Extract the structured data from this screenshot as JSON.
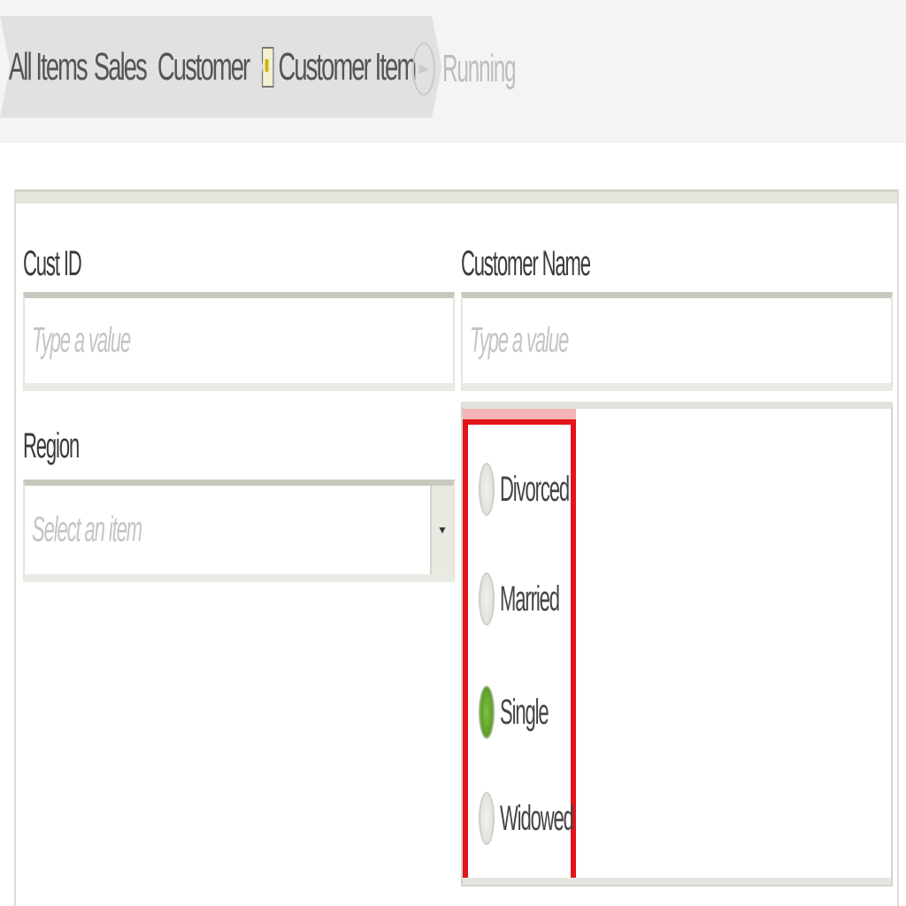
{
  "breadcrumb": {
    "items": [
      {
        "label": "All Items"
      },
      {
        "label": "Sales"
      },
      {
        "label": "Customer"
      },
      {
        "label": "Customer Item"
      }
    ],
    "status": "Running"
  },
  "form": {
    "cust_id": {
      "label": "Cust ID",
      "placeholder": "Type a value"
    },
    "customer_name": {
      "label": "Customer Name",
      "placeholder": "Type a value"
    },
    "region": {
      "label": "Region",
      "placeholder": "Select an item"
    },
    "marital_status": {
      "options": [
        {
          "label": "Divorced",
          "selected": false
        },
        {
          "label": "Married",
          "selected": false
        },
        {
          "label": "Single",
          "selected": true
        },
        {
          "label": "Widowed",
          "selected": false
        }
      ]
    }
  },
  "colors": {
    "highlight": "#e3141a",
    "radio_selected": "#5fa52a"
  }
}
